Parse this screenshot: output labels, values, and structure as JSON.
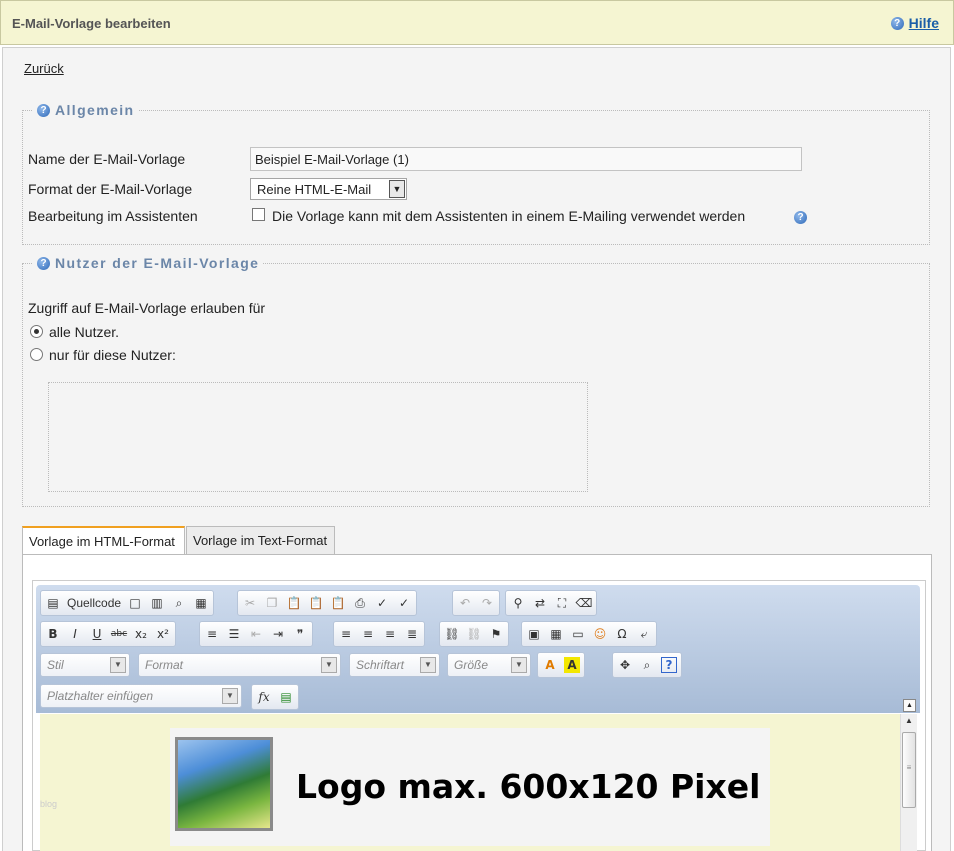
{
  "header": {
    "title": "E-Mail-Vorlage bearbeiten",
    "help_label": "Hilfe"
  },
  "nav": {
    "back_label": "Zurück"
  },
  "general": {
    "legend": "Allgemein",
    "name_label": "Name der E-Mail-Vorlage",
    "name_value": "Beispiel E-Mail-Vorlage (1)",
    "format_label": "Format der E-Mail-Vorlage",
    "format_value": "Reine HTML-E-Mail",
    "assistant_label": "Bearbeitung im Assistenten",
    "assistant_checkbox_label": "Die Vorlage kann mit dem Assistenten in einem E-Mailing verwendet werden",
    "assistant_checked": false
  },
  "users": {
    "legend": "Nutzer der E-Mail-Vorlage",
    "access_label": "Zugriff auf E-Mail-Vorlage erlauben für",
    "option_all": "alle Nutzer.",
    "option_specific": "nur für diese Nutzer:",
    "selected": "all"
  },
  "tabs": [
    {
      "label": "Vorlage im HTML-Format",
      "active": true
    },
    {
      "label": "Vorlage im Text-Format",
      "active": false
    }
  ],
  "editor": {
    "source_label": "Quellcode",
    "style_placeholder": "Stil",
    "format_placeholder": "Format",
    "font_placeholder": "Schriftart",
    "size_placeholder": "Größe",
    "placeholder_insert": "Platzhalter einfügen",
    "fx_label": "fx",
    "logo_text": "Logo max. 600x120 Pixel",
    "faint_text": "blog"
  },
  "colors": {
    "header_bg": "#f5f5d2",
    "link": "#1a5ea8",
    "legend": "#6b86a8",
    "toolbar": "#a7bbd6",
    "tab_accent": "#f0a020"
  }
}
